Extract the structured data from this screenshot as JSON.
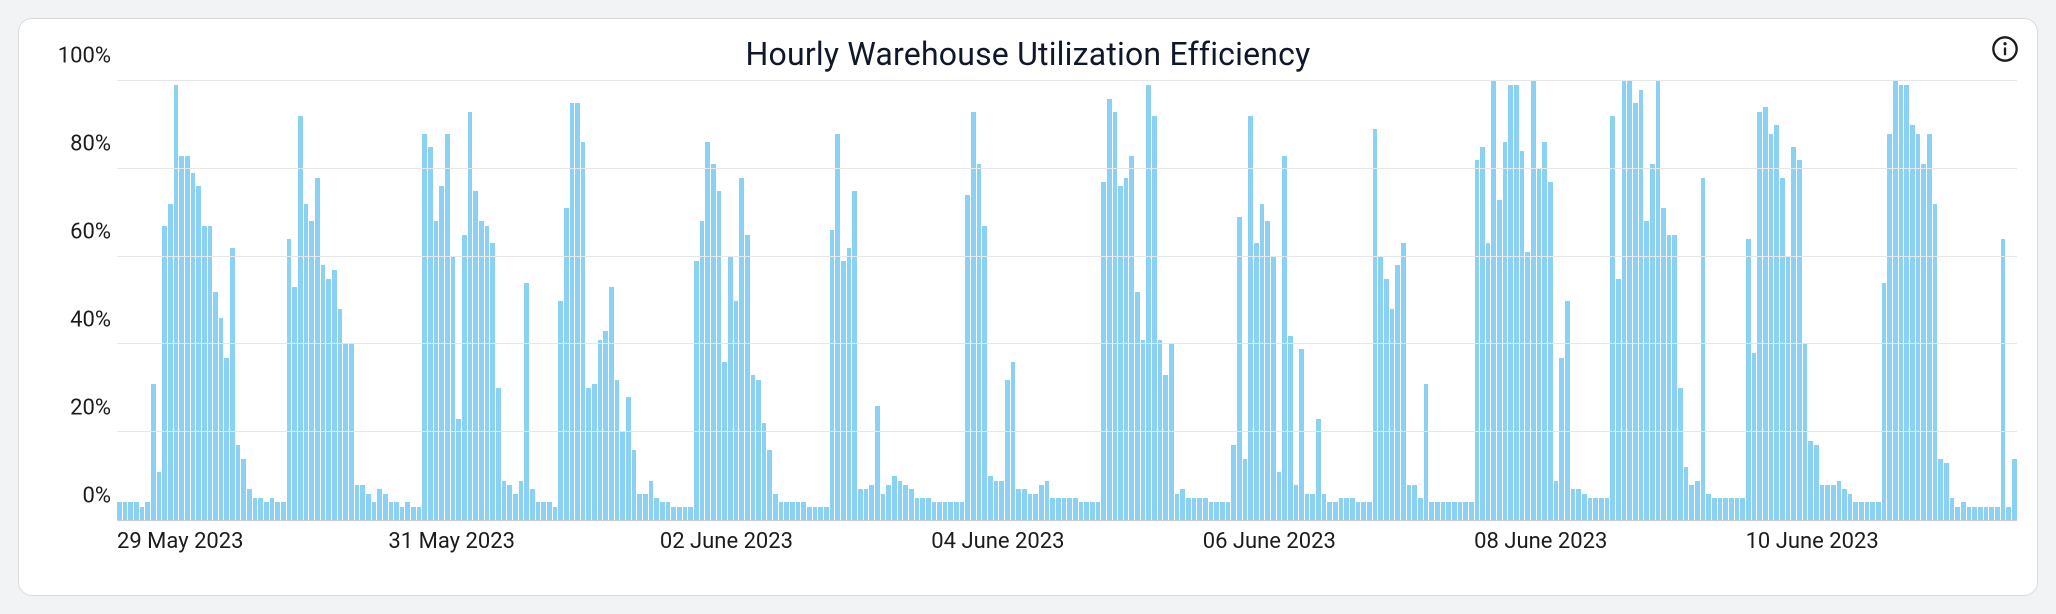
{
  "chart_data": {
    "type": "bar",
    "title": "Hourly Warehouse Utilization Efficiency",
    "xlabel": "",
    "ylabel": "",
    "ylim": [
      0,
      100
    ],
    "y_ticks": [
      0,
      20,
      40,
      60,
      80,
      100
    ],
    "y_tick_labels": [
      "0%",
      "20%",
      "40%",
      "60%",
      "80%",
      "100%"
    ],
    "x_tick_labels": [
      "29 May 2023",
      "31 May 2023",
      "02 June 2023",
      "04 June 2023",
      "06 June 2023",
      "08 June 2023",
      "10 June 2023"
    ],
    "categories_note": "hours from 29 May 2023 00:00 through 11 June 2023 23:00",
    "values": [
      4,
      4,
      4,
      4,
      3,
      4,
      31,
      11,
      67,
      72,
      99,
      83,
      83,
      79,
      76,
      67,
      67,
      52,
      46,
      37,
      62,
      17,
      14,
      7,
      5,
      5,
      4,
      5,
      4,
      4,
      64,
      53,
      92,
      72,
      68,
      78,
      58,
      55,
      57,
      48,
      40,
      40,
      8,
      8,
      6,
      4,
      7,
      6,
      4,
      4,
      3,
      4,
      3,
      3,
      88,
      85,
      68,
      76,
      88,
      60,
      23,
      65,
      93,
      75,
      68,
      67,
      63,
      30,
      9,
      8,
      6,
      9,
      54,
      7,
      4,
      4,
      4,
      3,
      50,
      71,
      95,
      95,
      86,
      30,
      31,
      41,
      43,
      53,
      32,
      20,
      28,
      16,
      6,
      6,
      9,
      5,
      4,
      4,
      3,
      3,
      3,
      3,
      59,
      68,
      86,
      81,
      75,
      36,
      60,
      50,
      78,
      65,
      33,
      32,
      22,
      16,
      6,
      4,
      4,
      4,
      4,
      4,
      3,
      3,
      3,
      3,
      66,
      88,
      59,
      62,
      75,
      7,
      7,
      8,
      26,
      6,
      8,
      10,
      9,
      8,
      7,
      5,
      5,
      5,
      4,
      4,
      4,
      4,
      4,
      4,
      74,
      93,
      81,
      67,
      10,
      9,
      9,
      32,
      36,
      7,
      7,
      6,
      6,
      8,
      9,
      5,
      5,
      5,
      5,
      5,
      4,
      4,
      4,
      4,
      77,
      96,
      93,
      76,
      78,
      83,
      52,
      41,
      99,
      92,
      41,
      33,
      40,
      6,
      7,
      5,
      5,
      5,
      5,
      4,
      4,
      4,
      4,
      17,
      69,
      14,
      92,
      63,
      72,
      68,
      60,
      11,
      83,
      42,
      8,
      39,
      6,
      6,
      23,
      6,
      4,
      4,
      5,
      5,
      5,
      4,
      4,
      4,
      89,
      60,
      55,
      48,
      58,
      63,
      8,
      8,
      5,
      31,
      4,
      4,
      4,
      4,
      4,
      4,
      4,
      4,
      82,
      85,
      63,
      100,
      73,
      86,
      99,
      99,
      84,
      61,
      100,
      80,
      86,
      77,
      9,
      37,
      50,
      7,
      7,
      6,
      5,
      5,
      5,
      5,
      92,
      55,
      100,
      100,
      95,
      98,
      68,
      81,
      100,
      71,
      65,
      65,
      30,
      12,
      8,
      9,
      78,
      6,
      5,
      5,
      5,
      5,
      5,
      5,
      64,
      38,
      93,
      94,
      88,
      90,
      78,
      60,
      85,
      82,
      40,
      18,
      17,
      8,
      8,
      8,
      9,
      7,
      6,
      4,
      4,
      4,
      4,
      4,
      54,
      88,
      100,
      99,
      99,
      90,
      88,
      81,
      88,
      72,
      14,
      13,
      5,
      3,
      4,
      3,
      3,
      3,
      3,
      3,
      3,
      64,
      3,
      14
    ]
  },
  "icons": {
    "info": "info-icon"
  }
}
